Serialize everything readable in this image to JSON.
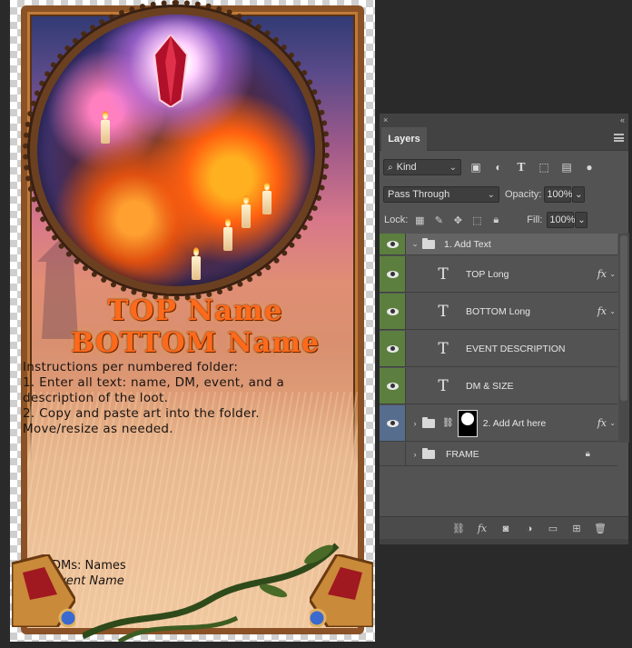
{
  "card": {
    "top_name": "TOP Name",
    "bottom_name": "BOTTOM Name",
    "instructions": [
      "Instructions per numbered folder:",
      "1. Enter all text: name, DM, event, and a",
      "description of the loot.",
      "2. Copy and paste art into the folder.",
      "Move/resize as needed."
    ],
    "dm_line": "DMs: Names",
    "event_line": "Event Name"
  },
  "layers_panel": {
    "collapse_glyph": "«",
    "close_glyph": "×",
    "tab_label": "Layers",
    "filter_kind": "Kind",
    "blend_mode": "Pass Through",
    "opacity_label": "Opacity:",
    "opacity_value": "100%",
    "lock_label": "Lock:",
    "fill_label": "Fill:",
    "fill_value": "100%",
    "fx_label": "fx",
    "layers": [
      {
        "name": "1. Add Text",
        "kind": "group",
        "expanded": true,
        "visible": true,
        "eye_color": "green"
      },
      {
        "name": "TOP Long",
        "kind": "text",
        "has_fx": true,
        "visible": true,
        "eye_color": "green"
      },
      {
        "name": "BOTTOM Long",
        "kind": "text",
        "has_fx": true,
        "visible": true,
        "eye_color": "green"
      },
      {
        "name": "EVENT DESCRIPTION",
        "kind": "text",
        "has_fx": false,
        "visible": true,
        "eye_color": "green"
      },
      {
        "name": "DM & SIZE",
        "kind": "text",
        "has_fx": false,
        "visible": true,
        "eye_color": "green"
      },
      {
        "name": "2. Add Art here",
        "kind": "group-masked",
        "expanded": false,
        "has_fx": true,
        "visible": true,
        "eye_color": "blue"
      },
      {
        "name": "FRAME",
        "kind": "group",
        "expanded": false,
        "locked": true,
        "visible": false
      }
    ]
  },
  "colors": {
    "panel_bg": "#535353",
    "eye_green": "#5c7f3f",
    "eye_blue": "#566d8e",
    "title_orange": "#ff6a1a"
  }
}
